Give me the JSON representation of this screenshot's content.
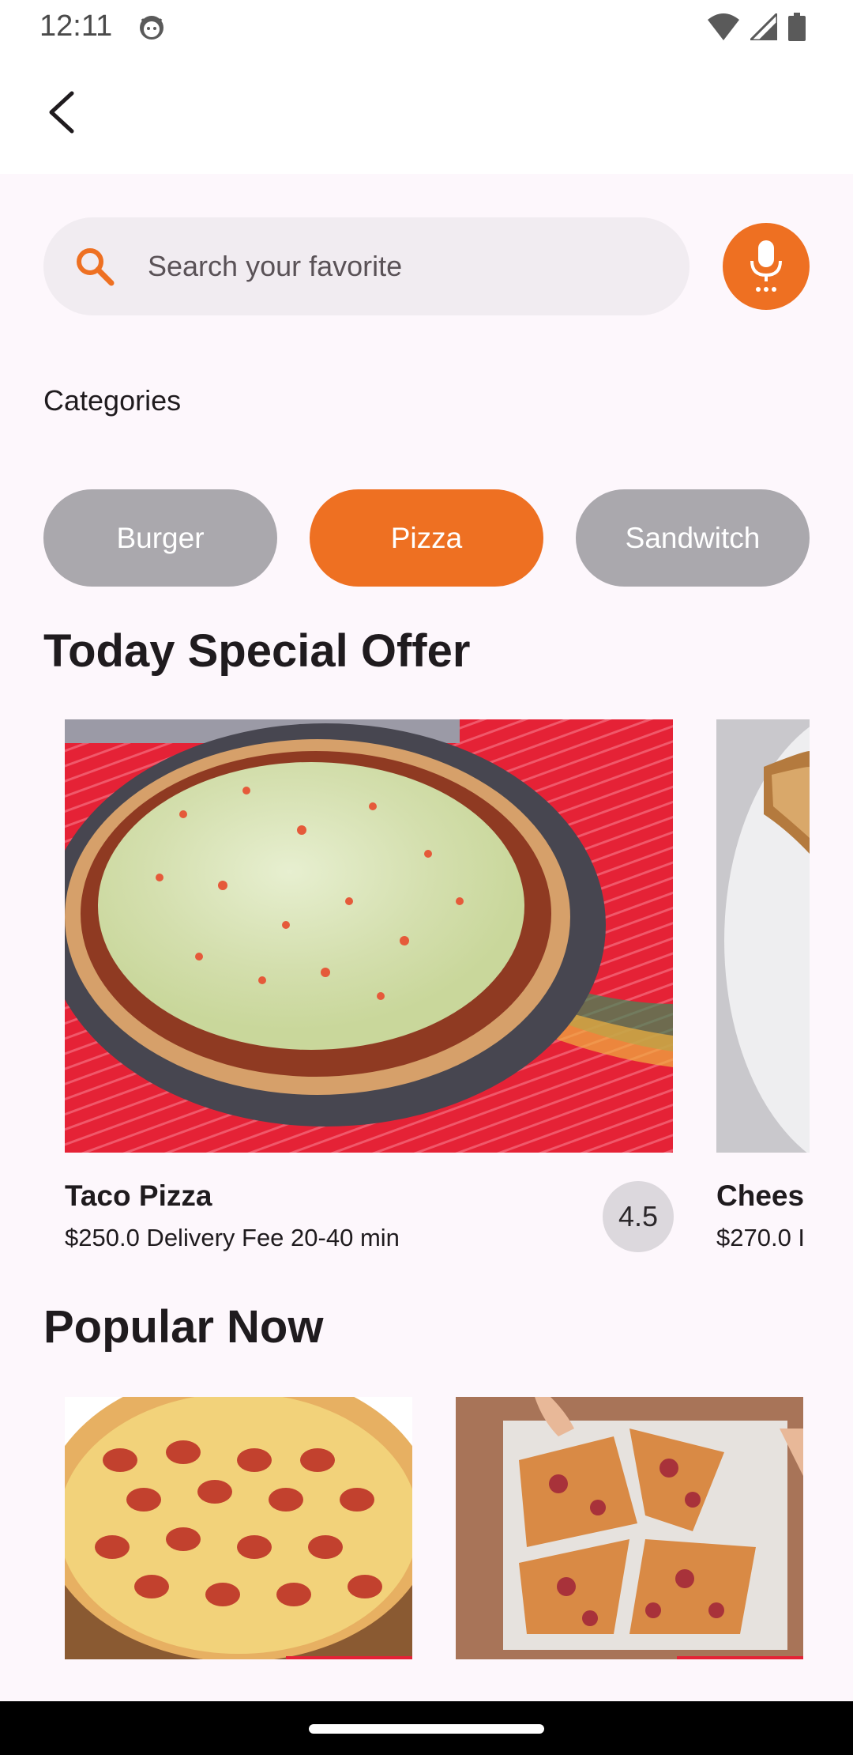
{
  "status_bar": {
    "time": "12:11"
  },
  "search": {
    "placeholder": "Search your favorite"
  },
  "categories": {
    "title": "Categories",
    "items": [
      {
        "label": "Burger",
        "active": false
      },
      {
        "label": "Pizza",
        "active": true
      },
      {
        "label": "Sandwitch",
        "active": false
      }
    ]
  },
  "special_offer": {
    "title": "Today Special Offer",
    "cards": [
      {
        "name": "Taco Pizza",
        "meta": "$250.0 Delivery Fee 20-40 min",
        "rating": "4.5"
      },
      {
        "name": "Chees",
        "meta": "$270.0 I"
      }
    ]
  },
  "popular": {
    "title": "Popular Now",
    "items": [
      {
        "image": "pepperoni-pizza"
      },
      {
        "image": "sliced-pizza"
      }
    ]
  },
  "colors": {
    "accent": "#ee7022",
    "chip_inactive": "#aaa8ad",
    "background": "#fdf7fc"
  }
}
